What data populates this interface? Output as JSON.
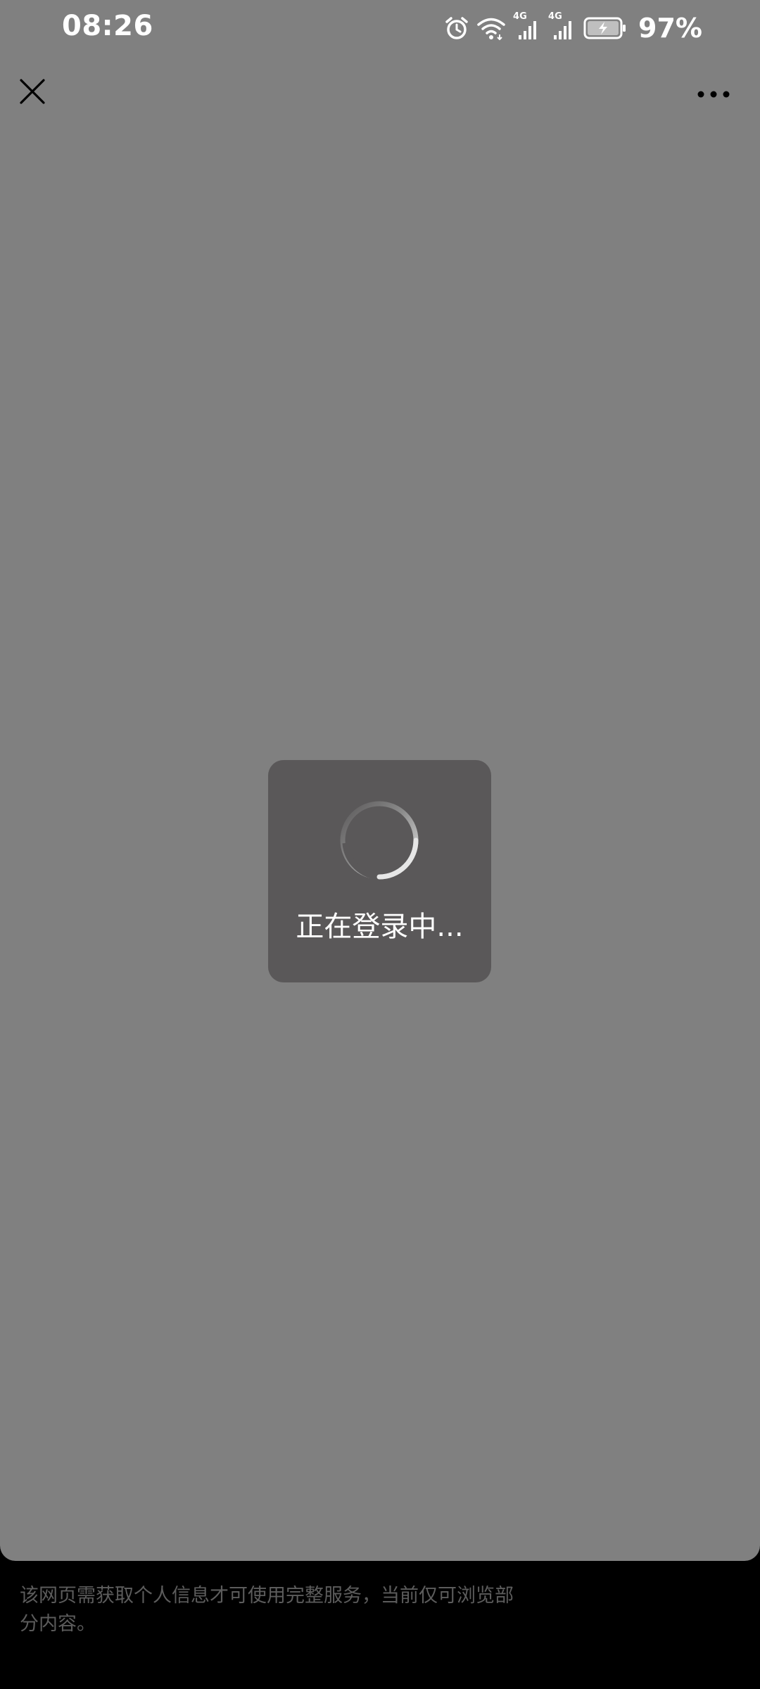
{
  "status_bar": {
    "time": "08:26",
    "battery_percent": "97%",
    "network_label_1": "4G",
    "network_label_2": "4G",
    "icons": [
      "alarm-icon",
      "wifi-icon",
      "signal-icon",
      "signal-icon",
      "battery-charging-icon"
    ]
  },
  "nav": {
    "close_icon": "close-icon",
    "more_icon": "more-horizontal-icon"
  },
  "loading": {
    "text": "正在登录中..."
  },
  "notice": {
    "text": "该网页需获取个人信息才可使用完整服务，当前仅可浏览部分内容。"
  },
  "colors": {
    "webview_background": "#808080",
    "toast_background": "#5a5859",
    "page_background": "#000000",
    "notice_text": "#5c5c5c"
  }
}
